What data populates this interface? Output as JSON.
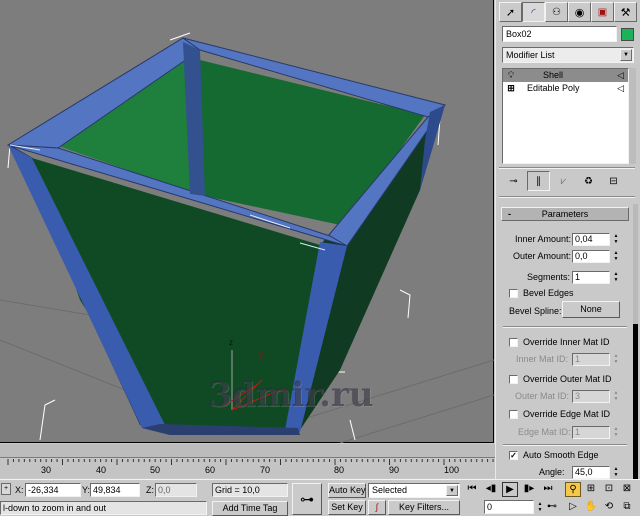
{
  "object_name": "Box02",
  "object_color": "#1db15a",
  "modifier_list": {
    "label": "Modifier List"
  },
  "modifier_stack": [
    {
      "label": "Shell",
      "glyph": "bulb-icon",
      "selected": true
    },
    {
      "label": "Editable Poly",
      "glyph": "plus-icon",
      "selected": false
    }
  ],
  "parameters": {
    "title": "Parameters",
    "collapse_glyph": "-",
    "inner_amount": {
      "label": "Inner Amount:",
      "value": "0,04"
    },
    "outer_amount": {
      "label": "Outer Amount:",
      "value": "0,0"
    },
    "segments": {
      "label": "Segments:",
      "value": "1"
    },
    "bevel_edges": {
      "label": "Bevel Edges",
      "checked": false
    },
    "bevel_spline": {
      "label": "Bevel Spline:",
      "button": "None"
    },
    "override_inner": {
      "label": "Override Inner Mat ID",
      "checked": false
    },
    "inner_mat_id": {
      "label": "Inner Mat ID:",
      "value": "1"
    },
    "override_outer": {
      "label": "Override Outer Mat ID",
      "checked": false
    },
    "outer_mat_id": {
      "label": "Outer Mat ID:",
      "value": "3"
    },
    "override_edge": {
      "label": "Override Edge Mat ID",
      "checked": false
    },
    "edge_mat_id": {
      "label": "Edge Mat ID:",
      "value": "1"
    },
    "auto_smooth": {
      "label": "Auto Smooth Edge",
      "checked": true,
      "check_glyph": "✓"
    },
    "angle": {
      "label": "Angle:",
      "value": "45,0"
    }
  },
  "viewport": {
    "watermark": "3dmir.ru",
    "background": "#7d7d7d",
    "gizmo_axes": {
      "x": "x",
      "y": "y",
      "z": "z"
    }
  },
  "timeline": {
    "ticks": [
      "30",
      "40",
      "50",
      "60",
      "70",
      "80",
      "90",
      "100"
    ]
  },
  "status": {
    "prompt": "l-down to zoom in and out",
    "x_label": "X:",
    "x_value": "-26,334",
    "y_label": "Y:",
    "y_value": "49,834",
    "z_label": "Z:",
    "z_value": "0,0",
    "grid": "Grid = 10,0",
    "add_time_tag": "Add Time Tag",
    "auto_key": "Auto Key",
    "set_key": "Set Key",
    "selected": "Selected",
    "key_filters": "Key Filters...",
    "frame": "0"
  }
}
